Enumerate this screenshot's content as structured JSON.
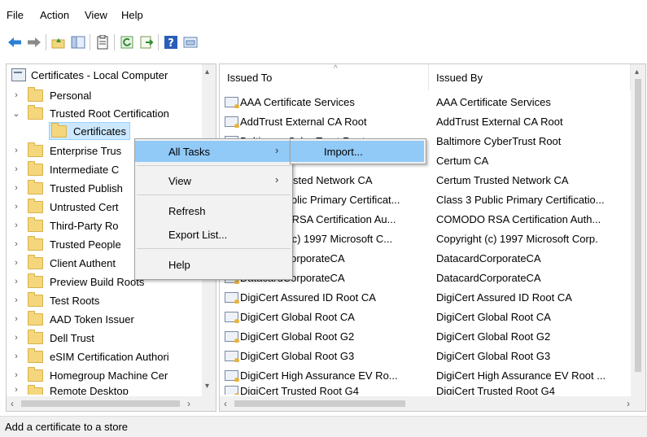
{
  "menubar": {
    "items": [
      "File",
      "Action",
      "View",
      "Help"
    ]
  },
  "toolbar": {
    "icons": [
      "back-icon",
      "forward-icon",
      "up-folder-icon",
      "show-hide-tree-icon",
      "properties-icon",
      "refresh-icon",
      "export-list-icon",
      "help-icon",
      "console-tree-icon"
    ]
  },
  "tree": {
    "root_label": "Certificates - Local Computer",
    "items": [
      {
        "label": "Personal"
      },
      {
        "label": "Trusted Root Certification"
      },
      {
        "label": "Certificates"
      },
      {
        "label": "Enterprise Trus"
      },
      {
        "label": "Intermediate C"
      },
      {
        "label": "Trusted Publish"
      },
      {
        "label": "Untrusted Cert"
      },
      {
        "label": "Third-Party Ro"
      },
      {
        "label": "Trusted People"
      },
      {
        "label": "Client Authent"
      },
      {
        "label": "Preview Build Roots"
      },
      {
        "label": "Test Roots"
      },
      {
        "label": "AAD Token Issuer"
      },
      {
        "label": "Dell Trust"
      },
      {
        "label": "eSIM Certification Authori"
      },
      {
        "label": "Homegroup Machine Cer"
      },
      {
        "label": "Remote Desktop"
      }
    ]
  },
  "list": {
    "columns": [
      "Issued To",
      "Issued By"
    ],
    "rows": [
      {
        "issued_to": "AAA Certificate Services",
        "issued_by": "AAA Certificate Services"
      },
      {
        "issued_to": "AddTrust External CA Root",
        "issued_by": "AddTrust External CA Root"
      },
      {
        "issued_to": "Baltimore CyberTrust Root",
        "issued_by": "Baltimore CyberTrust Root"
      },
      {
        "issued_to": "Certum CA",
        "issued_by": "Certum CA"
      },
      {
        "issued_to": "Certum Trusted Network CA",
        "issued_by": "Certum Trusted Network CA"
      },
      {
        "issued_to": "Class 3 Public Primary Certificat...",
        "issued_by": "Class 3 Public Primary Certificatio..."
      },
      {
        "issued_to": "COMODO RSA Certification Au...",
        "issued_by": "COMODO RSA Certification Auth..."
      },
      {
        "issued_to": "Copyright (c) 1997 Microsoft C...",
        "issued_by": "Copyright (c) 1997 Microsoft Corp."
      },
      {
        "issued_to": "DatacardCorporateCA",
        "issued_by": "DatacardCorporateCA"
      },
      {
        "issued_to": "DatacardCorporateCA",
        "issued_by": "DatacardCorporateCA"
      },
      {
        "issued_to": "DigiCert Assured ID Root CA",
        "issued_by": "DigiCert Assured ID Root CA"
      },
      {
        "issued_to": "DigiCert Global Root CA",
        "issued_by": "DigiCert Global Root CA"
      },
      {
        "issued_to": "DigiCert Global Root G2",
        "issued_by": "DigiCert Global Root G2"
      },
      {
        "issued_to": "DigiCert Global Root G3",
        "issued_by": "DigiCert Global Root G3"
      },
      {
        "issued_to": "DigiCert High Assurance EV Ro...",
        "issued_by": "DigiCert High Assurance EV Root ..."
      },
      {
        "issued_to": "DigiCert Trusted Root G4",
        "issued_by": "DigiCert Trusted Root G4"
      }
    ]
  },
  "context_menu": {
    "items": [
      "All Tasks",
      "View",
      "Refresh",
      "Export List...",
      "Help"
    ]
  },
  "submenu": {
    "items": [
      "Import..."
    ]
  },
  "status": {
    "text": "Add a certificate to a store"
  },
  "colors": {
    "selection": "#cce8ff",
    "menu_highlight": "#91c9f7",
    "folder": "#f4d77c",
    "toolbar_accent": "#2a7fd4"
  }
}
